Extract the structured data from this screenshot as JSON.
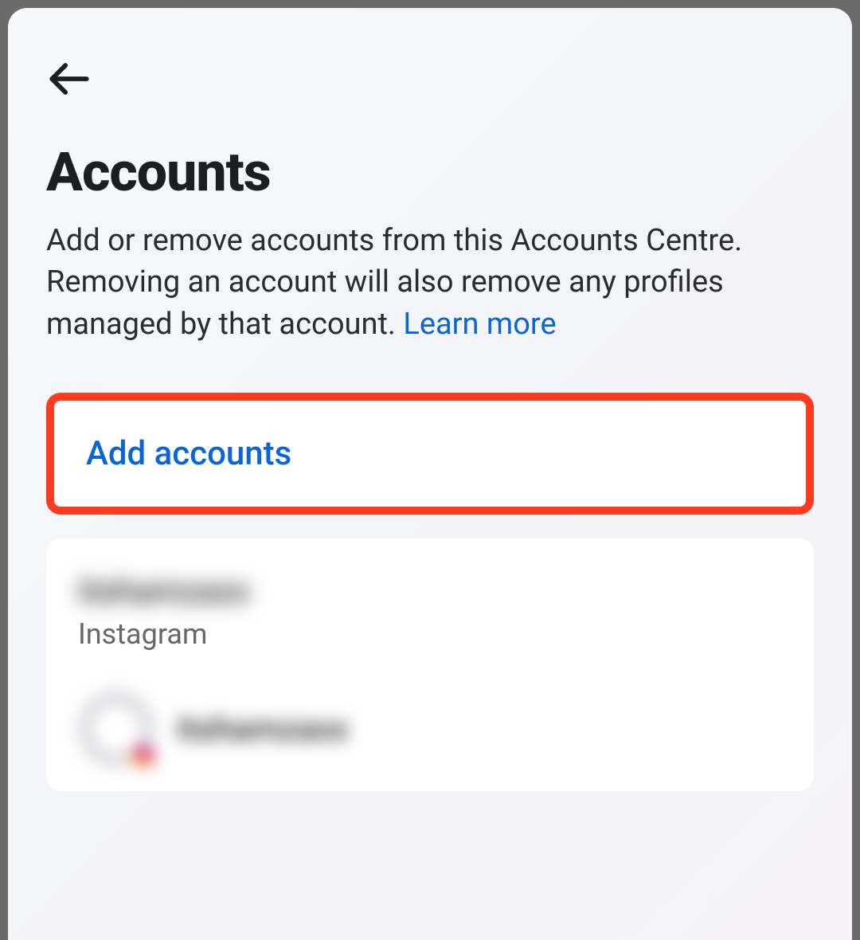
{
  "header": {
    "title": "Accounts"
  },
  "description": {
    "text": "Add or remove accounts from this Accounts Centre. Removing an account will also remove any profiles managed by that account. ",
    "learn_more": "Learn more"
  },
  "actions": {
    "add_accounts": "Add accounts"
  },
  "account": {
    "username": "itshamzaxx",
    "platform": "Instagram",
    "profile_name": "itshamzaxx"
  }
}
